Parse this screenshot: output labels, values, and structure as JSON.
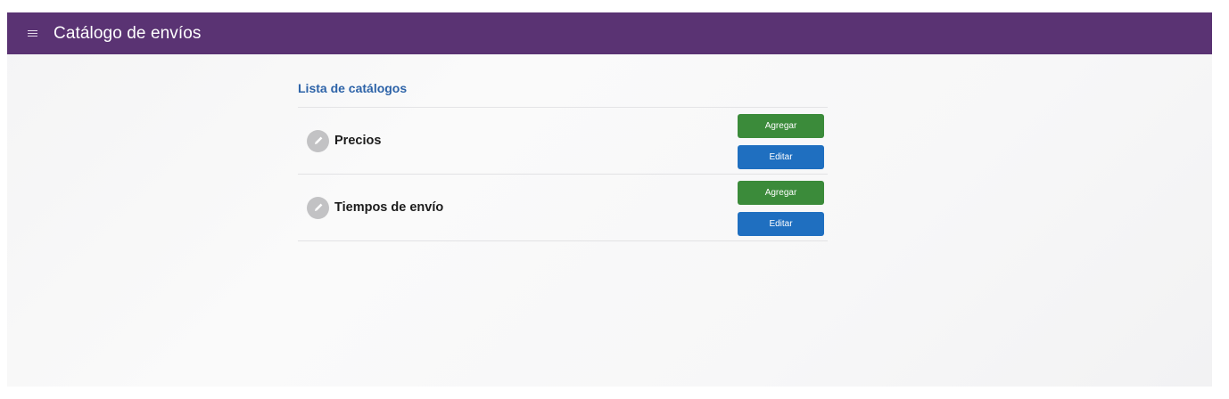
{
  "header": {
    "title": "Catálogo de envíos",
    "menu_icon": "hamburger-menu-icon",
    "background_color": "#5a3373"
  },
  "catalog": {
    "title": "Lista de catálogos",
    "title_color": "#2d63a8",
    "items": [
      {
        "label": "Precios",
        "icon": "pencil-icon",
        "add_label": "Agregar",
        "edit_label": "Editar"
      },
      {
        "label": "Tiempos de envío",
        "icon": "pencil-icon",
        "add_label": "Agregar",
        "edit_label": "Editar"
      }
    ]
  },
  "colors": {
    "add_button": "#3b8b3a",
    "edit_button": "#1f6fc0"
  }
}
